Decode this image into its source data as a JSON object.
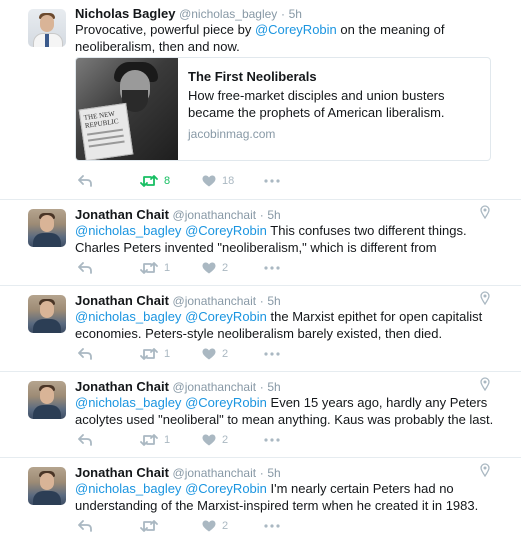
{
  "tweets": [
    {
      "name": "Nicholas Bagley",
      "handle": "@nicholas_bagley",
      "time": "5h",
      "text_parts": [
        "Provocative, powerful piece by ",
        "@CoreyRobin",
        " on the meaning of neoliberalism, then and now."
      ],
      "card": {
        "title": "The First Neoliberals",
        "description": "How free-market disciples and union busters became the prophets of American liberalism.",
        "domain": "jacobinmag.com",
        "image_text": "THE NEW REPUBLIC"
      },
      "retweets": "8",
      "likes": "18",
      "retweeted": true
    },
    {
      "name": "Jonathan Chait",
      "handle": "@jonathanchait",
      "time": "5h",
      "mention1": "@nicholas_bagley",
      "mention2": "@CoreyRobin",
      "text": " This confuses two different things. Charles Peters invented \"neoliberalism,\" which is different from",
      "retweets": "1",
      "likes": "2"
    },
    {
      "name": "Jonathan Chait",
      "handle": "@jonathanchait",
      "time": "5h",
      "mention1": "@nicholas_bagley",
      "mention2": "@CoreyRobin",
      "text": " the Marxist epithet for open capitalist economies. Peters-style neoliberalism barely existed, then died.",
      "retweets": "1",
      "likes": "2"
    },
    {
      "name": "Jonathan Chait",
      "handle": "@jonathanchait",
      "time": "5h",
      "mention1": "@nicholas_bagley",
      "mention2": "@CoreyRobin",
      "text": " Even 15 years ago, hardly any Peters acolytes used \"neoliberal\" to mean anything. Kaus was probably the last.",
      "retweets": "1",
      "likes": "2"
    },
    {
      "name": "Jonathan Chait",
      "handle": "@jonathanchait",
      "time": "5h",
      "mention1": "@nicholas_bagley",
      "mention2": "@CoreyRobin",
      "text": " I'm nearly certain Peters had no understanding of the Marxist-inspired term when he created it in 1983.",
      "retweets": "",
      "likes": "2"
    }
  ],
  "separator": "·",
  "colors": {
    "retweet_active": "#17bf63",
    "icon_gray": "#aab8c2",
    "link_blue": "#1b95e0"
  },
  "icons": [
    "reply-icon",
    "retweet-icon",
    "like-icon",
    "more-icon",
    "location-pin-icon"
  ]
}
